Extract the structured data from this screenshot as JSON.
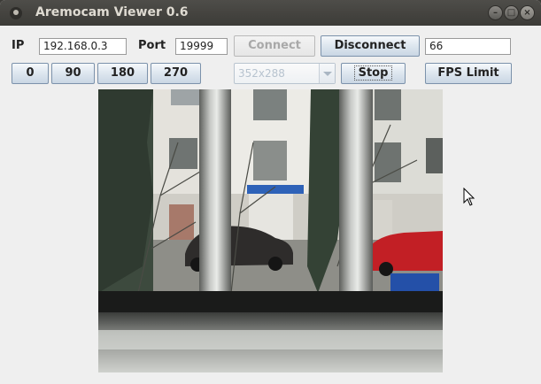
{
  "window": {
    "title": "Aremocam Viewer 0.6",
    "controls": [
      "minimize",
      "maximize",
      "close"
    ]
  },
  "connection": {
    "ip_label": "IP",
    "ip_value": "192.168.0.3",
    "port_label": "Port",
    "port_value": "19999",
    "connect_label": "Connect",
    "connect_enabled": false,
    "disconnect_label": "Disconnect",
    "fps_value": "66"
  },
  "rotation": {
    "buttons": [
      "0",
      "90",
      "180",
      "270"
    ]
  },
  "resolution": {
    "selected": "352x288",
    "enabled": false
  },
  "stream": {
    "stop_label": "Stop",
    "fps_limit_label": "FPS Limit"
  },
  "video": {
    "description_icon": "camera-feed"
  },
  "colors": {
    "titlebar": "#3c3b37",
    "window_bg": "#efefef",
    "button_border": "#7c92ab"
  }
}
